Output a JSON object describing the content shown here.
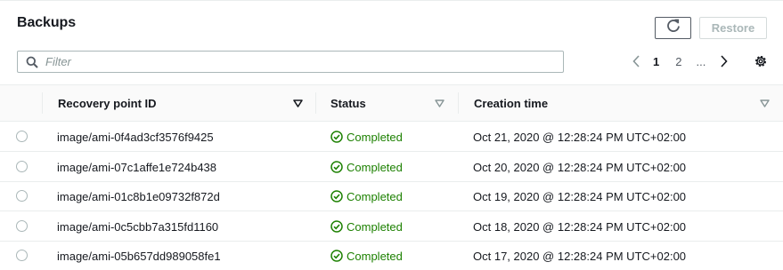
{
  "header": {
    "title": "Backups",
    "restore_label": "Restore"
  },
  "filter": {
    "placeholder": "Filter",
    "value": ""
  },
  "pagination": {
    "pages": [
      "1",
      "2",
      "..."
    ],
    "current": "1"
  },
  "table": {
    "columns": [
      "Recovery point ID",
      "Status",
      "Creation time"
    ],
    "rows": [
      {
        "id": "image/ami-0f4ad3cf3576f9425",
        "status": "Completed",
        "created": "Oct 21, 2020 @ 12:28:24 PM UTC+02:00"
      },
      {
        "id": "image/ami-07c1affe1e724b438",
        "status": "Completed",
        "created": "Oct 20, 2020 @ 12:28:24 PM UTC+02:00"
      },
      {
        "id": "image/ami-01c8b1e09732f872d",
        "status": "Completed",
        "created": "Oct 19, 2020 @ 12:28:24 PM UTC+02:00"
      },
      {
        "id": "image/ami-0c5cbb7a315fd1160",
        "status": "Completed",
        "created": "Oct 18, 2020 @ 12:28:24 PM UTC+02:00"
      },
      {
        "id": "image/ami-05b657dd989058fe1",
        "status": "Completed",
        "created": "Oct 17, 2020 @ 12:28:24 PM UTC+02:00"
      }
    ]
  },
  "icons": {
    "refresh": "refresh-icon",
    "search": "search-icon",
    "prev": "chevron-left-icon",
    "next": "chevron-right-icon",
    "settings": "gear-icon",
    "sort": "caret-down-icon",
    "status_ok": "check-circle-icon"
  },
  "colors": {
    "status_success": "#1d8102",
    "border": "#aab7b8",
    "text": "#16191f",
    "disabled_text": "#aab7b8"
  }
}
